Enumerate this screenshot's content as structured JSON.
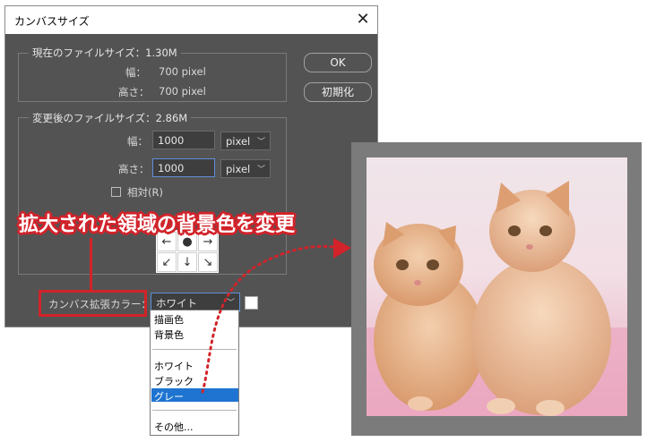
{
  "dialog": {
    "title": "カンバスサイズ",
    "close_glyph": "✕",
    "current": {
      "group_label": "現在のファイルサイズ：1.30M",
      "width_label": "幅：",
      "width_value": "700 pixel",
      "height_label": "高さ：",
      "height_value": "700 pixel"
    },
    "new": {
      "group_label": "変更後のファイルサイズ：2.86M",
      "width_label": "幅：",
      "width_value": "1000",
      "width_unit": "pixel",
      "height_label": "高さ：",
      "height_value": "1000",
      "height_unit": "pixel",
      "relative_label": "相対(R)"
    },
    "ok_label": "OK",
    "reset_label": "初期化",
    "anchor_arrows": [
      "↖",
      "↑",
      "↗",
      "←",
      "●",
      "→",
      "↙",
      "↓",
      "↘"
    ],
    "ext_color_label": "カンバス拡張カラー：",
    "ext_color_value": "ホワイト"
  },
  "dropdown": {
    "items_top": [
      "描画色",
      "背景色"
    ],
    "items_mid": [
      "ホワイト",
      "ブラック",
      "グレー"
    ],
    "items_bottom": [
      "その他..."
    ],
    "selected": "グレー"
  },
  "callout": {
    "text": "拡大された領域の背景色を変更"
  },
  "colors": {
    "dialog_bg": "#535353",
    "accent_red": "#d2232a",
    "highlight_blue": "#1e74d0",
    "frame_gray": "#7b7b7b"
  }
}
